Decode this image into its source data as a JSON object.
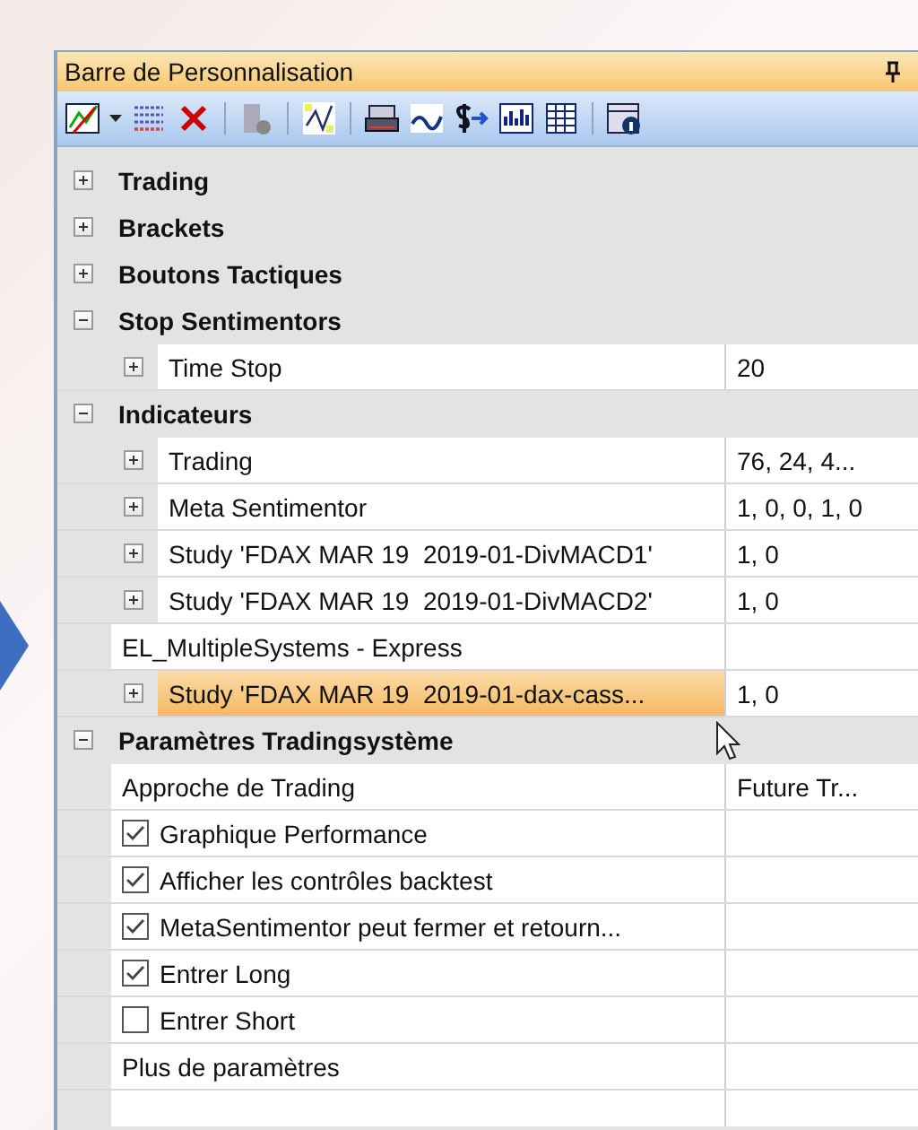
{
  "window": {
    "title": "Barre de Personnalisation"
  },
  "sections": [
    {
      "label": "Trading",
      "expanded": false
    },
    {
      "label": "Brackets",
      "expanded": false
    },
    {
      "label": "Boutons Tactiques",
      "expanded": false
    },
    {
      "label": "Stop Sentimentors",
      "expanded": true,
      "items": [
        {
          "kind": "expandable",
          "label": "Time Stop",
          "value": "20",
          "selected": false
        }
      ]
    },
    {
      "label": "Indicateurs",
      "expanded": true,
      "items": [
        {
          "kind": "expandable",
          "label": "Trading",
          "value": "76, 24, 4...",
          "selected": false
        },
        {
          "kind": "expandable",
          "label": "Meta Sentimentor",
          "value": "1, 0, 0, 1, 0",
          "selected": false
        },
        {
          "kind": "expandable",
          "label": "Study 'FDAX MAR 19  2019-01-DivMACD1'",
          "value": "1, 0",
          "selected": false
        },
        {
          "kind": "expandable",
          "label": "Study 'FDAX MAR 19  2019-01-DivMACD2'",
          "value": "1, 0",
          "selected": false
        },
        {
          "kind": "plain",
          "label": "EL_MultipleSystems - Express",
          "value": "",
          "selected": false
        },
        {
          "kind": "expandable",
          "label": "Study 'FDAX MAR 19  2019-01-dax-cass...",
          "value": "1, 0",
          "selected": true
        }
      ]
    },
    {
      "label": "Paramètres Tradingsystème",
      "expanded": true,
      "items": [
        {
          "kind": "plain",
          "label": "Approche de Trading",
          "value": "Future Tr...",
          "selected": false
        },
        {
          "kind": "checkbox",
          "label": "Graphique Performance",
          "checked": true,
          "selected": false
        },
        {
          "kind": "checkbox",
          "label": "Afficher les contrôles backtest",
          "checked": true,
          "selected": false
        },
        {
          "kind": "checkbox",
          "label": "MetaSentimentor peut fermer et retourn...",
          "checked": true,
          "selected": false
        },
        {
          "kind": "checkbox",
          "label": "Entrer Long",
          "checked": true,
          "selected": false
        },
        {
          "kind": "checkbox",
          "label": "Entrer Short",
          "checked": false,
          "selected": false
        },
        {
          "kind": "plain",
          "label": "Plus de paramètres",
          "value": "",
          "selected": false
        }
      ]
    }
  ]
}
